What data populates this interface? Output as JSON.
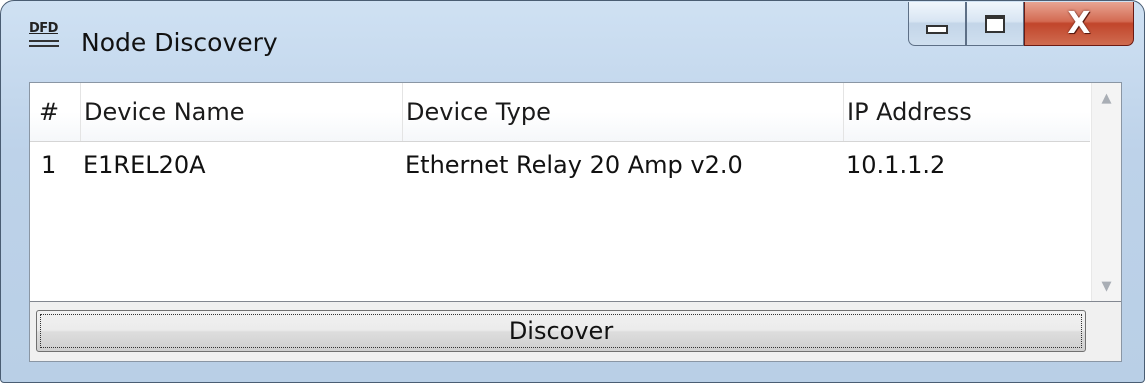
{
  "window": {
    "title": "Node Discovery",
    "app_icon": "DFD"
  },
  "title_controls": {
    "minimize_icon": "minimize-icon",
    "maximize_icon": "maximize-icon",
    "close_icon": "close-icon",
    "close_glyph": "X"
  },
  "list": {
    "columns": [
      "#",
      "Device Name",
      "Device Type",
      "IP Address"
    ],
    "rows": [
      {
        "num": "1",
        "name": "E1REL20A",
        "type": "Ethernet Relay 20 Amp v2.0",
        "ip": "10.1.1.2"
      }
    ]
  },
  "scrollbar": {
    "up_glyph": "▲",
    "down_glyph": "▼"
  },
  "discover_button": {
    "label": "Discover"
  },
  "colors": {
    "frame": "#bdd2e9",
    "close_button": "#c1452b"
  }
}
